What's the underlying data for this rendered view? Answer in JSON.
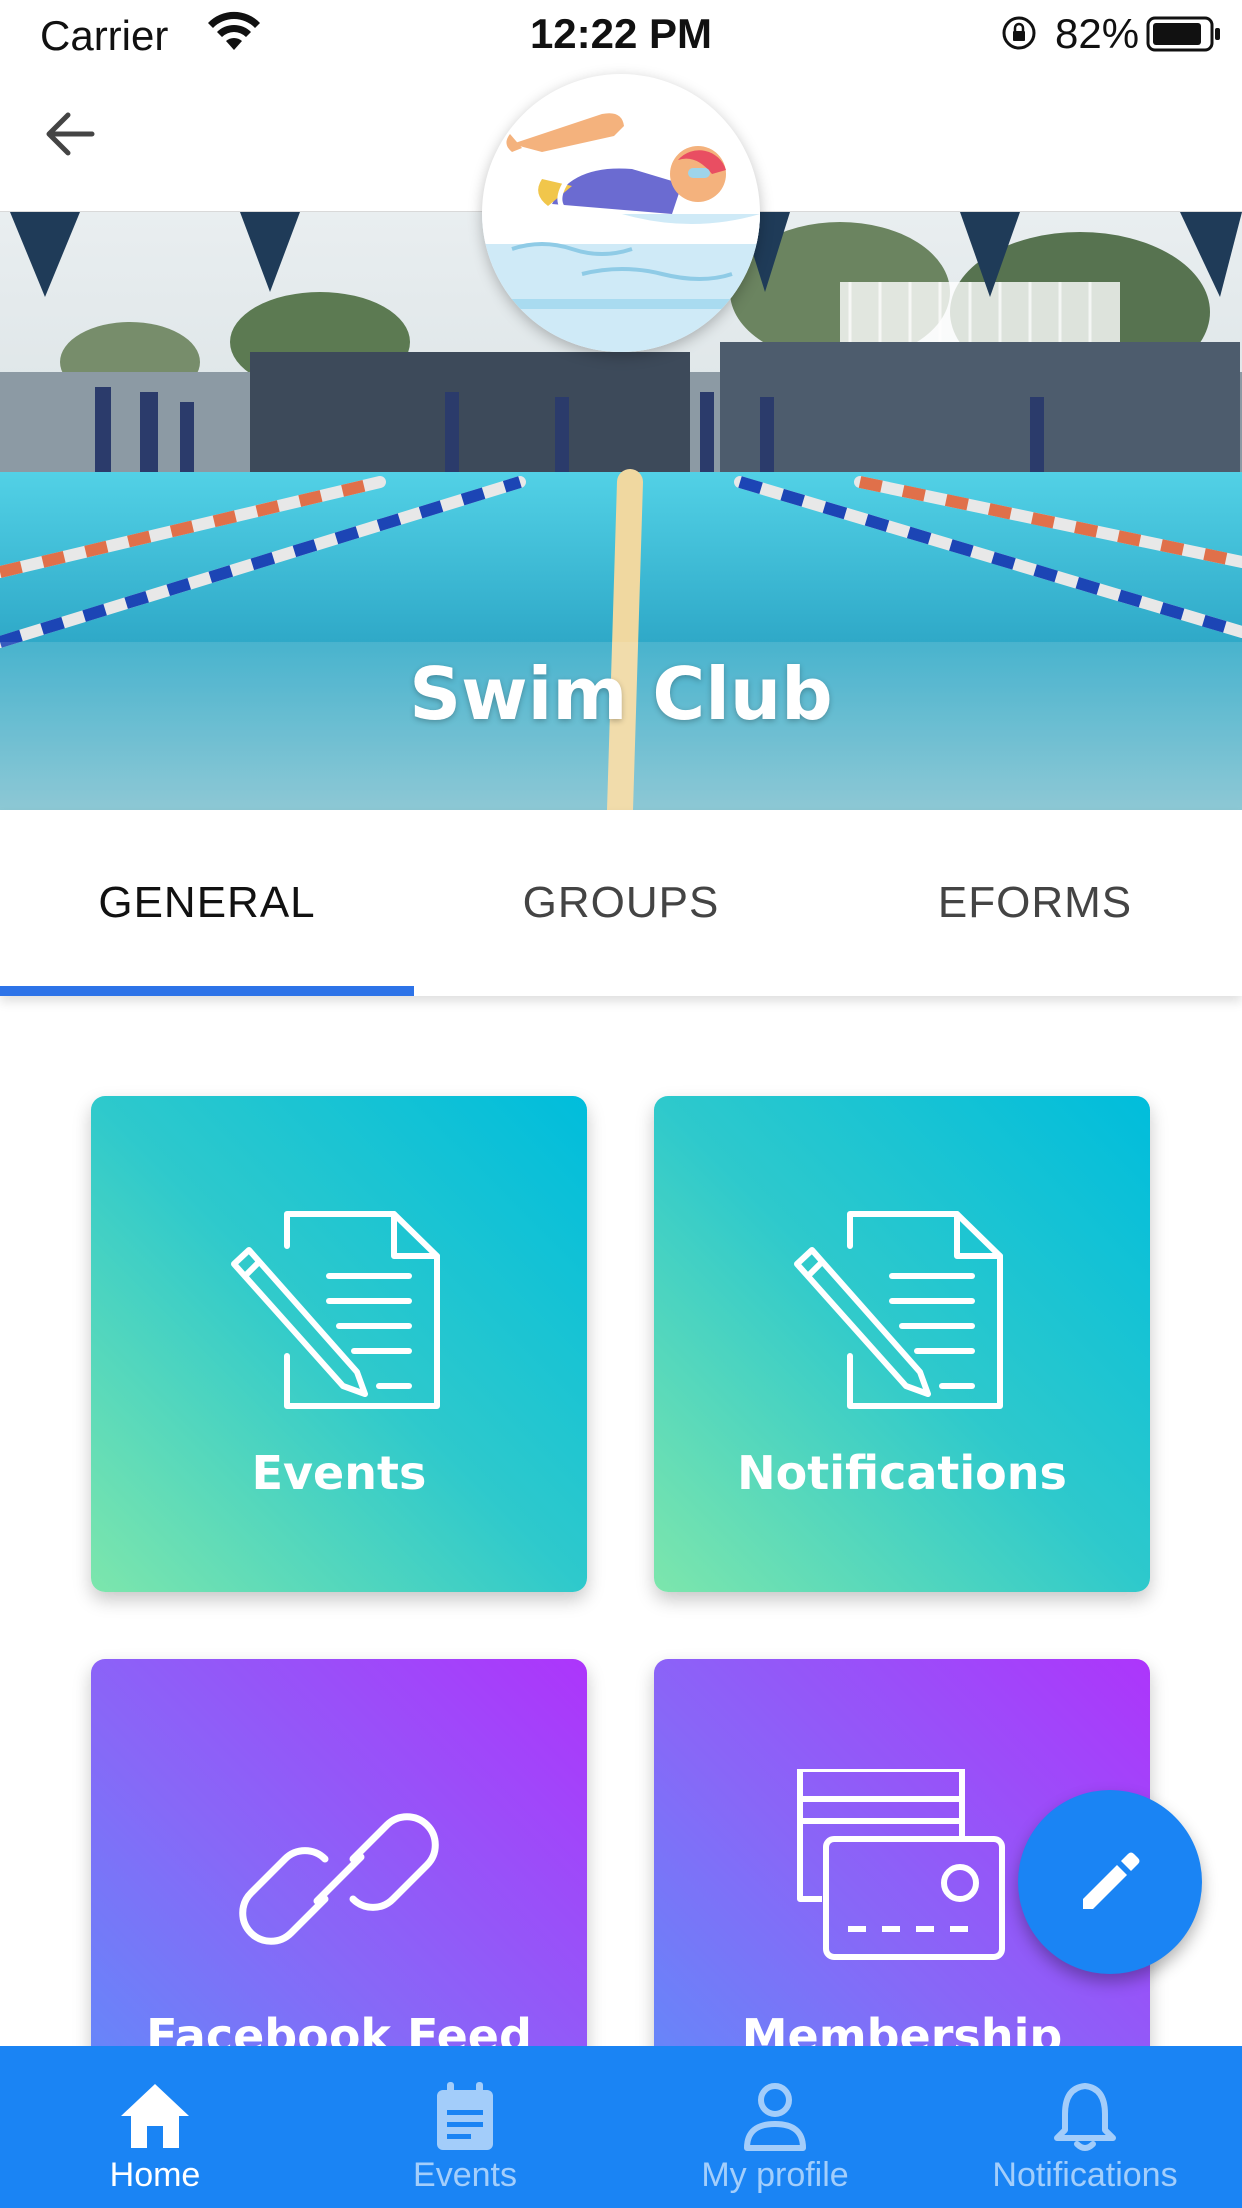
{
  "status_bar": {
    "carrier": "Carrier",
    "time": "12:22 PM",
    "battery": "82%"
  },
  "header": {
    "back_icon": "arrow-left-icon",
    "logo_icon": "swimmer-icon"
  },
  "hero": {
    "title": "Swim Club"
  },
  "tabs": [
    {
      "label": "GENERAL",
      "active": true
    },
    {
      "label": "GROUPS",
      "active": false
    },
    {
      "label": "EFORMS",
      "active": false
    }
  ],
  "tiles": [
    {
      "label": "Events",
      "icon": "document-edit-icon",
      "color": "#00bddc"
    },
    {
      "label": "Notifications",
      "icon": "document-edit-icon",
      "color": "#00bddc"
    },
    {
      "label": "Facebook Feed",
      "icon": "link-icon",
      "color": "#ad35fb"
    },
    {
      "label": "Membership",
      "icon": "credit-cards-icon",
      "color": "#ad35fb"
    }
  ],
  "fab": {
    "icon": "pencil-icon"
  },
  "bottom_nav": [
    {
      "label": "Home",
      "icon": "home-icon",
      "active": true
    },
    {
      "label": "Events",
      "icon": "calendar-icon",
      "active": false
    },
    {
      "label": "My profile",
      "icon": "person-icon",
      "active": false
    },
    {
      "label": "Notifications",
      "icon": "bell-icon",
      "active": false
    }
  ],
  "colors": {
    "accent": "#1a84f4",
    "tab_indicator": "#2d73e8"
  }
}
